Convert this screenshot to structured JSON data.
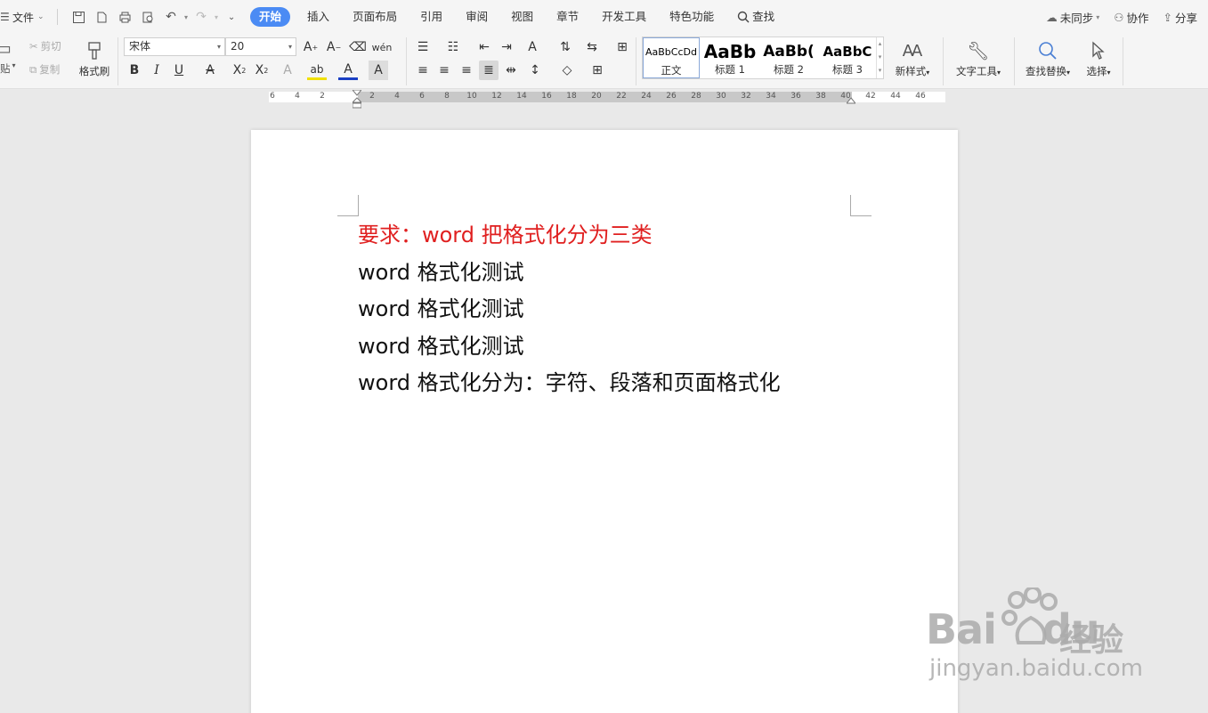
{
  "menubar": {
    "file_label": "文件",
    "tabs": [
      {
        "label": "开始",
        "active": true
      },
      {
        "label": "插入"
      },
      {
        "label": "页面布局"
      },
      {
        "label": "引用"
      },
      {
        "label": "审阅"
      },
      {
        "label": "视图"
      },
      {
        "label": "章节"
      },
      {
        "label": "开发工具"
      },
      {
        "label": "特色功能"
      }
    ],
    "search_label": "查找",
    "sync_label": "未同步",
    "collab_label": "协作",
    "share_label": "分享"
  },
  "ribbon": {
    "paste_label": "贴",
    "cut_label": "剪切",
    "copy_label": "复制",
    "format_painter_label": "格式刷",
    "font_name": "宋体",
    "font_size": "20",
    "styles": [
      {
        "preview": "AaBbCcDd",
        "name": "正文"
      },
      {
        "preview": "AaBb",
        "name": "标题 1"
      },
      {
        "preview": "AaBb(",
        "name": "标题 2"
      },
      {
        "preview": "AaBbC",
        "name": "标题 3"
      }
    ],
    "new_style_label": "新样式",
    "text_tools_label": "文字工具",
    "find_replace_label": "查找替换",
    "select_label": "选择"
  },
  "ruler": {
    "ticks": [
      "6",
      "4",
      "2",
      "2",
      "4",
      "6",
      "8",
      "10",
      "12",
      "14",
      "16",
      "18",
      "20",
      "22",
      "24",
      "26",
      "28",
      "30",
      "32",
      "34",
      "36",
      "38",
      "40",
      "42",
      "44",
      "46"
    ]
  },
  "document": {
    "lines": [
      "要求：word 把格式化分为三类",
      "word 格式化测试",
      "word 格式化测试",
      "word 格式化测试",
      "word 格式化分为：字符、段落和页面格式化"
    ]
  },
  "watermark": {
    "brand": "Bai",
    "brand_suffix": "du",
    "cn": "经验",
    "url": "jingyan.baidu.com"
  }
}
